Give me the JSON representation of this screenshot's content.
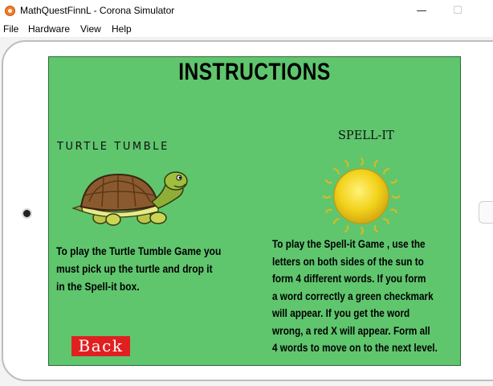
{
  "window": {
    "title": "MathQuestFinnL - Corona Simulator",
    "minimize": "—",
    "maximize": "☐"
  },
  "menu": [
    "File",
    "Hardware",
    "View",
    "Help"
  ],
  "screen": {
    "heading": "INSTRUCTIONS",
    "turtle_game_title": "TURTLE TUMBLE",
    "spell_game_title": "SPELL-IT",
    "turtle_instructions": [
      "To play the Turtle Tumble Game you",
      "must pick up the turtle and drop it",
      "in the Spell-it box."
    ],
    "spell_instructions": [
      "To play the Spell-it Game , use the",
      "letters on both sides of the sun to",
      "form 4 different words. If you form",
      "a word correctly a green checkmark",
      "will appear. If you get the word",
      "wrong, a red X will appear. Form all",
      "4 words to move on to the next level."
    ],
    "back_label": "Back"
  },
  "colors": {
    "screen_bg": "#5fc66e",
    "back_button": "#e02020",
    "sun": "#f2d21a"
  },
  "icons": {
    "app": "corona-simulator-icon",
    "turtle": "turtle-icon",
    "sun": "sun-icon"
  }
}
